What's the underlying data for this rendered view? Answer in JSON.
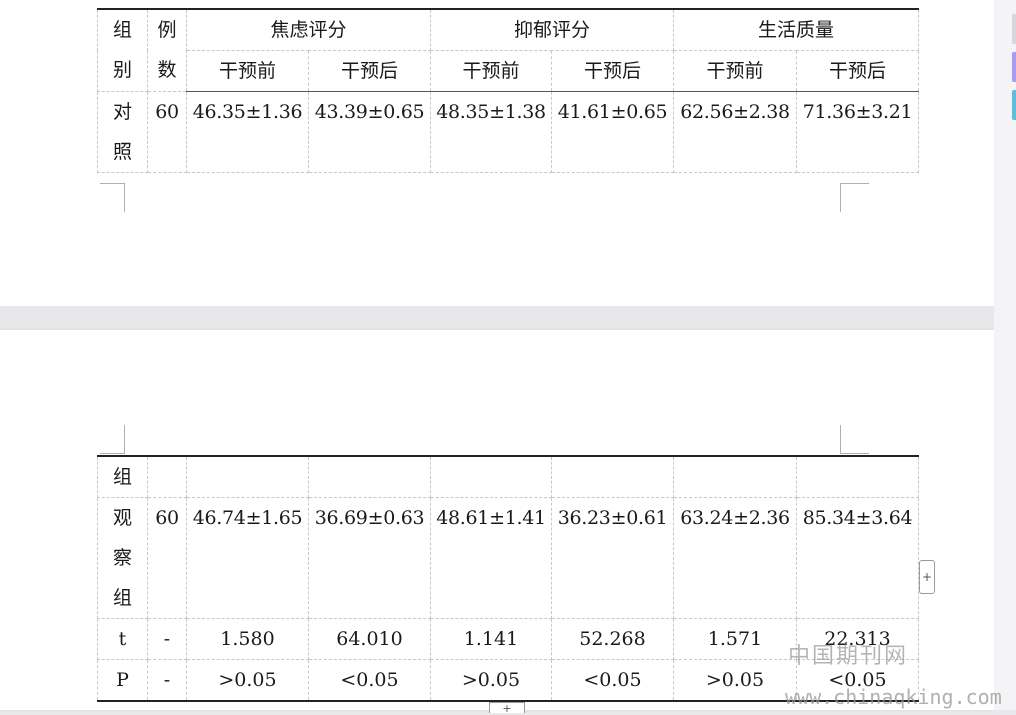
{
  "table_top": {
    "header_row1": {
      "group": [
        "组",
        "别"
      ],
      "count": [
        "例",
        "数"
      ],
      "anxiety": "焦虑评分",
      "depression": "抑郁评分",
      "quality": "生活质量"
    },
    "header_row2": [
      "干预前",
      "干预后",
      "干预前",
      "干预后",
      "干预前",
      "干预后"
    ],
    "control_row": {
      "group": [
        "对",
        "照"
      ],
      "count": "60",
      "values": [
        "46.35±1.36",
        "43.39±0.65",
        "48.35±1.38",
        "41.61±0.65",
        "62.56±2.38",
        "71.36±3.21"
      ]
    }
  },
  "table_bottom": {
    "continued_group": "组",
    "observation_row": {
      "group": [
        "观",
        "察",
        "组"
      ],
      "count": "60",
      "values": [
        "46.74±1.65",
        "36.69±0.63",
        "48.61±1.41",
        "36.23±0.61",
        "63.24±2.36",
        "85.34±3.64"
      ]
    },
    "t_row": {
      "label": "t",
      "count": "-",
      "values": [
        "1.580",
        "64.010",
        "1.141",
        "52.268",
        "1.571",
        "22.313"
      ]
    },
    "p_row": {
      "label": "P",
      "count": "-",
      "values": [
        ">0.05",
        "<0.05",
        ">0.05",
        "<0.05",
        ">0.05",
        "<0.05"
      ]
    }
  },
  "controls": {
    "add_row_side": "+",
    "add_row_bottom": "+"
  },
  "watermark": {
    "cn": "中国期刊网",
    "url": "www.chinaqking.com"
  },
  "colors": {
    "edge_tab_top": "#c9c9d6",
    "edge_tab_purple": "#a89cf0",
    "edge_tab_cyan": "#5bc0de"
  }
}
